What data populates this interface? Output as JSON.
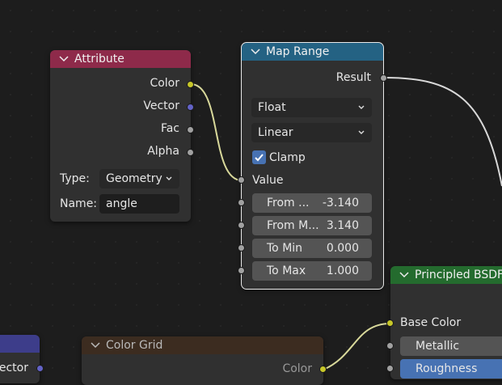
{
  "attribute_node": {
    "title": "Attribute",
    "outputs": [
      "Color",
      "Vector",
      "Fac",
      "Alpha"
    ],
    "type_label": "Type:",
    "type_value": "Geometry",
    "name_label": "Name:",
    "name_value": "angle"
  },
  "map_range_node": {
    "title": "Map Range",
    "output": "Result",
    "data_type": "Float",
    "interpolation": "Linear",
    "clamp_label": "Clamp",
    "clamp_checked": true,
    "value_label": "Value",
    "fields": [
      {
        "label": "From ...",
        "value": "-3.140"
      },
      {
        "label": "From M...",
        "value": "3.140"
      },
      {
        "label": "To Min",
        "value": "0.000"
      },
      {
        "label": "To Max",
        "value": "1.000"
      }
    ]
  },
  "principled_node": {
    "title": "Principled BSDF",
    "base_color_label": "Base Color",
    "metallic_label": "Metallic",
    "roughness_label": "Roughness"
  },
  "color_grid_node": {
    "title": "Color Grid",
    "color_label": "Color"
  },
  "vector_node": {
    "partial_label": "ector"
  },
  "colors": {
    "attribute_header": "#8e2a4a",
    "map_range_header": "#246283",
    "principled_header": "#246b2e",
    "color_grid_header": "#3c2c20",
    "vector_header": "#3d3d8a",
    "wire": "#dcdca0"
  }
}
